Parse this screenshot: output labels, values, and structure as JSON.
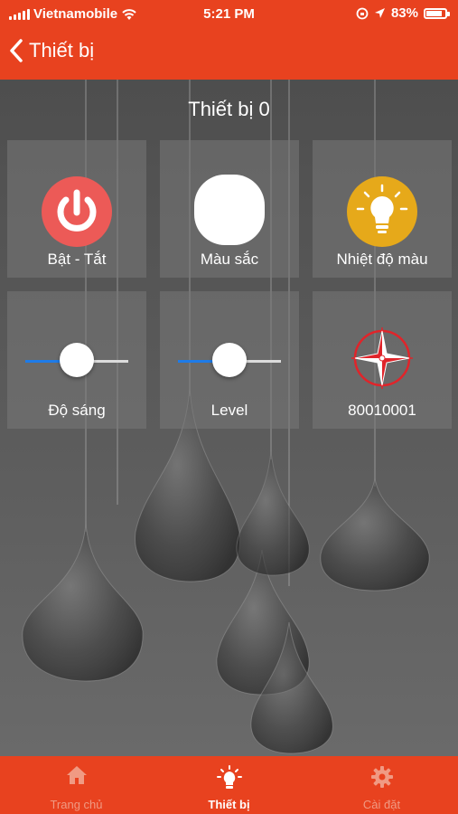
{
  "status_bar": {
    "carrier": "Vietnamobile",
    "time": "5:21 PM",
    "battery_percent": "83%",
    "battery_level": 0.83,
    "signal_icon": "signal-bars-icon",
    "wifi_icon": "wifi-icon",
    "lock_icon": "rotation-lock-icon",
    "location_icon": "location-arrow-icon"
  },
  "nav": {
    "back_label": "Thiết bị",
    "back_icon": "chevron-left-icon"
  },
  "device": {
    "title": "Thiết bị 0"
  },
  "tiles": {
    "power": {
      "label": "Bật - Tắt",
      "icon": "power-icon"
    },
    "color": {
      "label": "Màu sắc",
      "icon": "color-swatch-icon"
    },
    "temperature": {
      "label": "Nhiệt độ màu",
      "icon": "bulb-icon"
    },
    "brightness": {
      "label": "Độ sáng",
      "value": 0.5
    },
    "level": {
      "label": "Level",
      "value": 0.5
    },
    "address": {
      "label": "80010001",
      "icon": "compass-icon"
    }
  },
  "tabs": [
    {
      "label": "Trang chủ",
      "icon": "home-icon",
      "active": false
    },
    {
      "label": "Thiết bị",
      "icon": "bulb-icon",
      "active": true
    },
    {
      "label": "Cài đặt",
      "icon": "gear-icon",
      "active": false
    }
  ],
  "colors": {
    "accent": "#e8421f",
    "power_red": "#ec5a57",
    "bulb_yellow": "#e6a91a",
    "slider_blue": "#1e7be8"
  }
}
